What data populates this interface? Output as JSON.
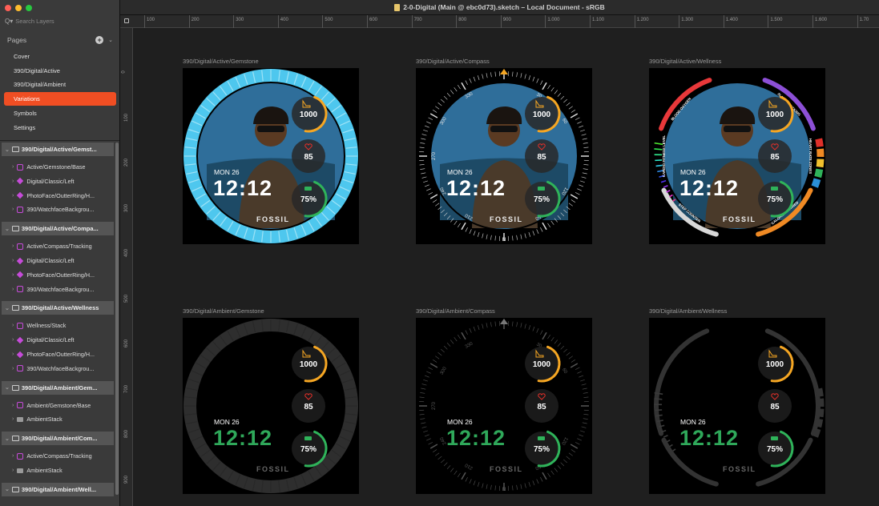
{
  "window": {
    "title": "2-0-Digital (Main @ ebc0d73).sketch – Local Document - sRGB",
    "traffic_lights": [
      "#ff5f57",
      "#febc2e",
      "#28c840"
    ]
  },
  "sidebar": {
    "search_placeholder": "Search Layers",
    "pages_label": "Pages",
    "pages": [
      {
        "label": "Cover"
      },
      {
        "label": "390/Digital/Active"
      },
      {
        "label": "390/Digital/Ambient"
      },
      {
        "label": "Variations",
        "selected": true
      },
      {
        "label": "Symbols"
      },
      {
        "label": "Settings"
      }
    ],
    "layer_groups": [
      {
        "label": "390/Digital/Active/Gemst...",
        "children": [
          {
            "label": "Active/Gemstone/Base",
            "icon": "symbol-instance-icon"
          },
          {
            "label": "Digital/Classic/Left",
            "icon": "symbol-master-icon"
          },
          {
            "label": "PhotoFace/OutterRing/H...",
            "icon": "symbol-master-icon"
          },
          {
            "label": "390/WatchfaceBackgrou...",
            "icon": "symbol-instance-icon"
          }
        ]
      },
      {
        "label": "390/Digital/Active/Compa...",
        "children": [
          {
            "label": "Active/Compass/Tracking",
            "icon": "symbol-instance-icon"
          },
          {
            "label": "Digital/Classic/Left",
            "icon": "symbol-master-icon"
          },
          {
            "label": "PhotoFace/OutterRing/H...",
            "icon": "symbol-master-icon"
          },
          {
            "label": "390/WatchfaceBackgrou...",
            "icon": "symbol-instance-icon"
          }
        ]
      },
      {
        "label": "390/Digital/Active/Wellness",
        "children": [
          {
            "label": "Wellness/Stack",
            "icon": "symbol-instance-icon"
          },
          {
            "label": "Digital/Classic/Left",
            "icon": "symbol-master-icon"
          },
          {
            "label": "PhotoFace/OutterRing/H...",
            "icon": "symbol-master-icon"
          },
          {
            "label": "390/WatchfaceBackgrou...",
            "icon": "symbol-instance-icon"
          }
        ]
      },
      {
        "label": "390/Digital/Ambient/Gem...",
        "children": [
          {
            "label": "Ambient/Gemstone/Base",
            "icon": "symbol-instance-icon"
          },
          {
            "label": "AmbientStack",
            "icon": "folder-icon"
          }
        ]
      },
      {
        "label": "390/Digital/Ambient/Com...",
        "children": [
          {
            "label": "Active/Compass/Tracking",
            "icon": "symbol-instance-icon"
          },
          {
            "label": "AmbientStack",
            "icon": "folder-icon"
          }
        ]
      },
      {
        "label": "390/Digital/Ambient/Well...",
        "children": []
      }
    ]
  },
  "ruler": {
    "top_ticks": [
      "100",
      "200",
      "300",
      "400",
      "500",
      "600",
      "700",
      "800",
      "900",
      "1.000",
      "1.100",
      "1.200",
      "1.300",
      "1.400",
      "1.500",
      "1.600",
      "1.70"
    ],
    "left_ticks": [
      "0",
      "100",
      "200",
      "300",
      "400",
      "500",
      "600",
      "700",
      "800",
      "900"
    ]
  },
  "artboards": [
    {
      "label": "390/Digital/Active/Gemstone",
      "ring": "gemstone",
      "ambient": false
    },
    {
      "label": "390/Digital/Active/Compass",
      "ring": "compass",
      "ambient": false
    },
    {
      "label": "390/Digital/Active/Wellness",
      "ring": "wellness",
      "ambient": false
    },
    {
      "label": "390/Digital/Ambient/Gemstone",
      "ring": "gemstone",
      "ambient": true
    },
    {
      "label": "390/Digital/Ambient/Compass",
      "ring": "compass",
      "ambient": true
    },
    {
      "label": "390/Digital/Ambient/Wellness",
      "ring": "wellness",
      "ambient": true
    }
  ],
  "watchface": {
    "date": "MON 26",
    "time": "12:12",
    "brand": "FOSSIL",
    "steps": "1000",
    "heart_rate": "85",
    "battery": "75%",
    "compass_north": "N",
    "compass_marks": [
      "30",
      "60",
      "120",
      "150",
      "210",
      "240",
      "270",
      "300",
      "330"
    ],
    "wellness_labels": [
      "BLOOD OXYGEN",
      "SLEEP TRACKING",
      "HEART RATE ZONES",
      "CALORIES BURNED",
      "STEP COUNTER",
      "CARDIO FITNESS LEVEL"
    ]
  },
  "colors": {
    "accent_selected": "#f04e23",
    "steps": "#f5a623",
    "heart": "#e0302a",
    "battery": "#2fb35a",
    "gemstone": "#4ec7ee",
    "time_ambient": "#2fa85a",
    "time_active": "#ffffff",
    "wellness_oxygen": "#e8383a",
    "wellness_sleep": "#8c4fd6",
    "wellness_calories": "#f08a24",
    "wellness_steps": "#d8d8d8"
  }
}
